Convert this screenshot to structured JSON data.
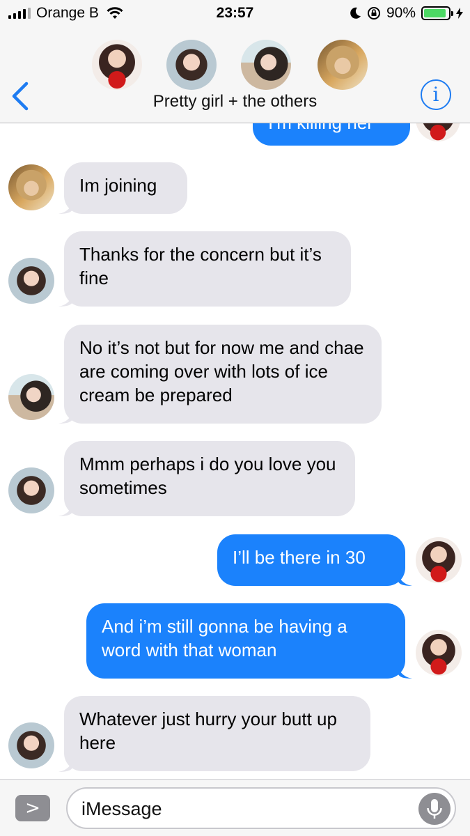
{
  "status_bar": {
    "carrier": "Orange B",
    "time": "23:57",
    "battery_percent": "90%",
    "battery_level": 0.9,
    "icons": [
      "signal-icon",
      "wifi-icon",
      "moon-icon",
      "rotation-lock-icon",
      "battery-icon",
      "charging-icon"
    ]
  },
  "header": {
    "group_name": "Pretty girl + the others",
    "info_label": "i",
    "participants": [
      "chaeyoung-avatar",
      "nayeon-avatar",
      "beach-avatar",
      "blonde-avatar"
    ]
  },
  "messages": [
    {
      "direction": "out",
      "text": "I'm killing her"
    },
    {
      "direction": "in",
      "text": "Im joining"
    },
    {
      "direction": "in",
      "text": "Thanks for the concern but it’s fine"
    },
    {
      "direction": "in",
      "text": "No it’s not but for now me and chae are coming over with lots of ice cream be prepared"
    },
    {
      "direction": "in",
      "text": "Mmm perhaps i do you love you sometimes"
    },
    {
      "direction": "out",
      "text": "I’ll be there in 30"
    },
    {
      "direction": "out",
      "text": "And i’m still gonna be having a word with that woman"
    },
    {
      "direction": "in",
      "text": "Whatever just hurry your butt up here"
    }
  ],
  "input": {
    "placeholder": "iMessage",
    "apps_label": ">"
  },
  "colors": {
    "outgoing_bubble": "#1b82fc",
    "incoming_bubble": "#e6e5eb",
    "accent": "#1e7cf2",
    "battery": "#4cd964"
  }
}
